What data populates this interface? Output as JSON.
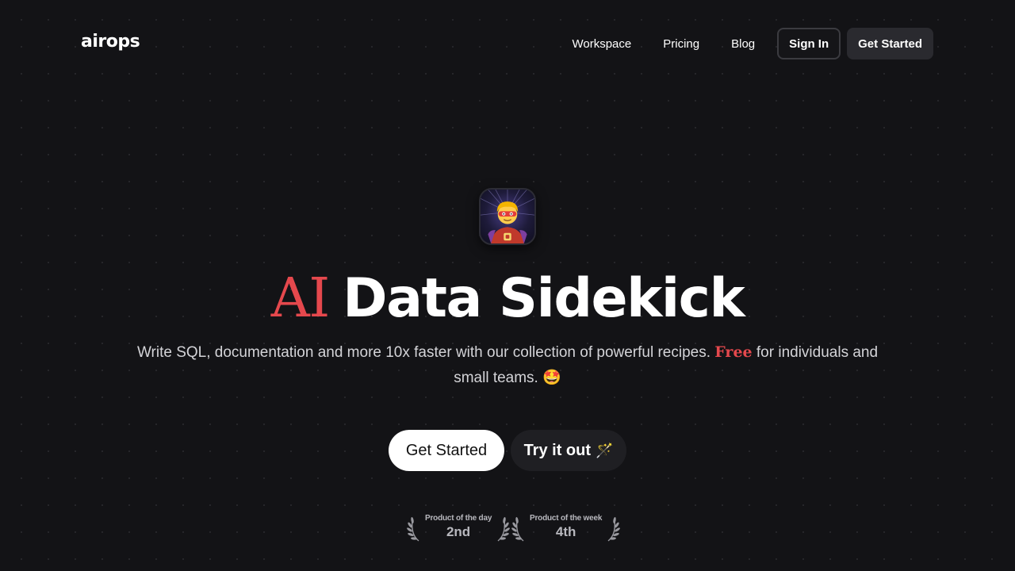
{
  "brand": {
    "logo_text": "airops"
  },
  "nav": {
    "links": [
      "Workspace",
      "Pricing",
      "Blog"
    ],
    "sign_in": "Sign In",
    "get_started": "Get Started"
  },
  "hero": {
    "icon": "superhero-emoji-icon",
    "headline_accent": "AI",
    "headline_rest": "Data Sidekick",
    "subtitle_before": "Write SQL, documentation and more 10x faster with our collection of powerful recipes.",
    "subtitle_highlight": "Free",
    "subtitle_after": "for individuals and small teams.",
    "subtitle_emoji": "🤩",
    "cta_primary": "Get Started",
    "cta_secondary": "Try it out",
    "cta_secondary_emoji": "🪄"
  },
  "awards": [
    {
      "label": "Product of the day",
      "rank": "2nd"
    },
    {
      "label": "Product of the week",
      "rank": "4th"
    }
  ],
  "colors": {
    "background": "#131316",
    "accent_red": "#e5484d",
    "text": "#ffffff",
    "muted_text": "#d4d4d8"
  }
}
